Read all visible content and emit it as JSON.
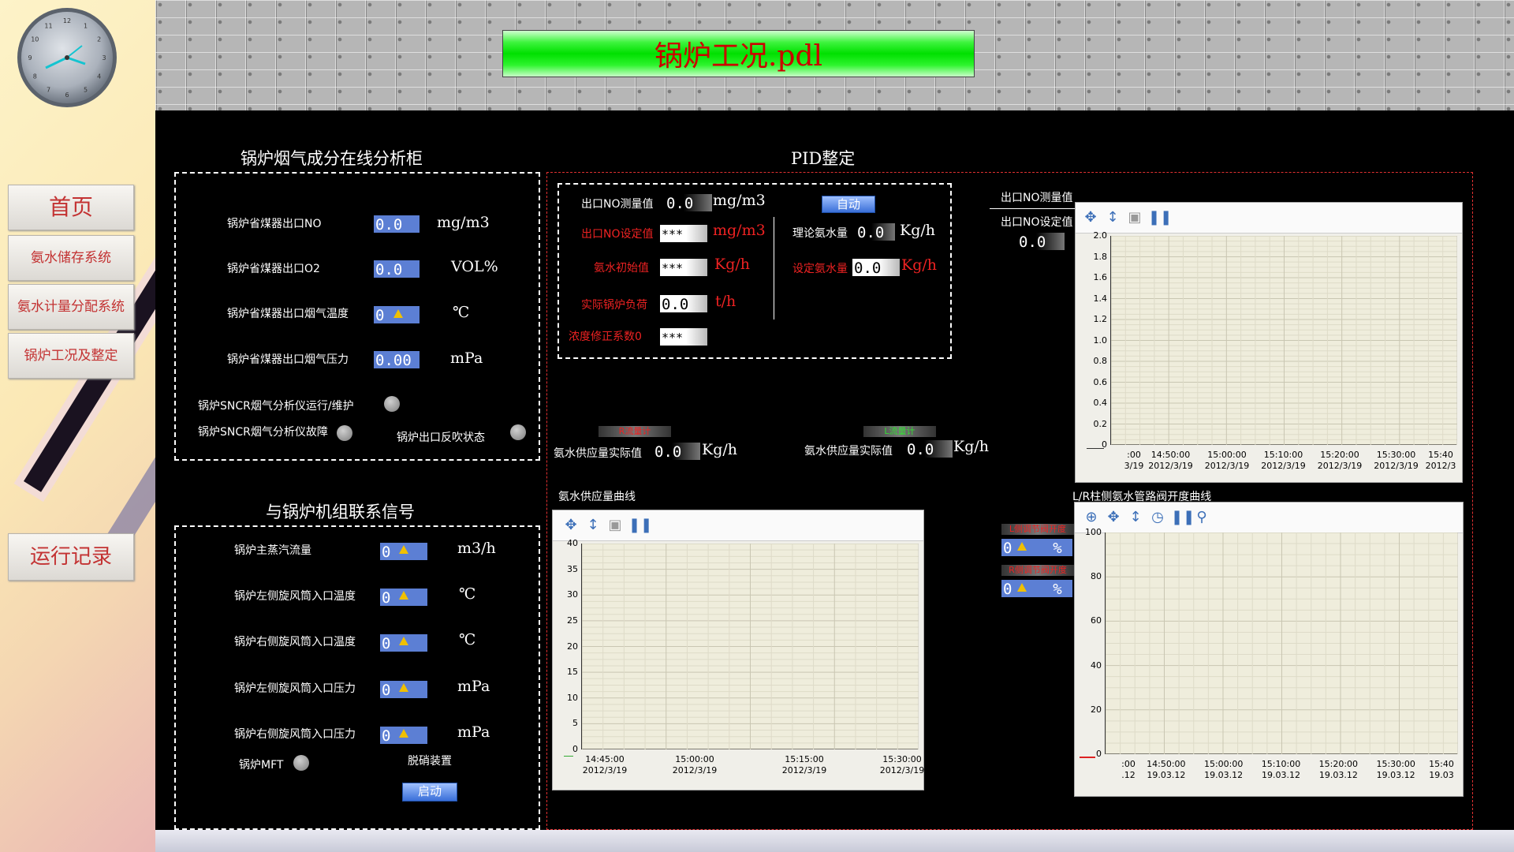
{
  "app_title": "锅炉工况.pdl",
  "sidebar": {
    "home": "首页",
    "items": [
      "氨水储存系统",
      "氨水计量分配系统",
      "锅炉工况及整定"
    ],
    "run_log": "运行记录",
    "clock_numbers": [
      "12",
      "1",
      "2",
      "3",
      "4",
      "5",
      "6",
      "7",
      "8",
      "9",
      "10",
      "11"
    ]
  },
  "analyzer": {
    "title": "锅炉烟气成分在线分析柜",
    "rows": [
      {
        "label": "锅炉省煤器出口NO",
        "value": "0.0",
        "unit": "mg/m3"
      },
      {
        "label": "锅炉省煤器出口O2",
        "value": "0.0",
        "unit": "VOL%"
      },
      {
        "label": "锅炉省煤器出口烟气温度",
        "value": "0",
        "unit": "℃"
      },
      {
        "label": "锅炉省煤器出口烟气压力",
        "value": "0.00",
        "unit": "mPa"
      }
    ],
    "status1": "锅炉SNCR烟气分析仪运行/维护",
    "status2": "锅炉SNCR烟气分析仪故障",
    "status3": "锅炉出口反吹状态"
  },
  "boiler_link": {
    "title": "与锅炉机组联系信号",
    "rows": [
      {
        "label": "锅炉主蒸汽流量",
        "value": "0",
        "unit": "m3/h"
      },
      {
        "label": "锅炉左侧旋风筒入口温度",
        "value": "0",
        "unit": "℃"
      },
      {
        "label": "锅炉右侧旋风筒入口温度",
        "value": "0",
        "unit": "℃"
      },
      {
        "label": "锅炉左侧旋风筒入口压力",
        "value": "0",
        "unit": "mPa"
      },
      {
        "label": "锅炉右侧旋风筒入口压力",
        "value": "0",
        "unit": "mPa"
      }
    ],
    "mft": "锅炉MFT",
    "denox": "脱硝装置",
    "start": "启动"
  },
  "pid": {
    "title": "PID整定",
    "out_no_meas_label": "出口NO测量值",
    "out_no_meas_value": "0.0",
    "out_no_meas_unit": "mg/m3",
    "out_no_set_label": "出口NO设定值",
    "out_no_set_value": "***",
    "out_no_set_unit": "mg/m3",
    "nh3_init_label": "氨水初始值",
    "nh3_init_value": "***",
    "nh3_init_unit": "Kg/h",
    "load_label": "实际锅炉负荷",
    "load_value": "0.0",
    "load_unit": "t/h",
    "conc_label": "浓度修正系数0",
    "conc_value": "***",
    "auto_btn": "自动",
    "theory_label": "理论氨水量",
    "theory_value": "0.0",
    "theory_unit": "Kg/h",
    "set_nh3_label": "设定氨水量",
    "set_nh3_value": "0.0",
    "set_nh3_unit": "Kg/h",
    "right_meas_label": "出口NO测量值",
    "right_set_label": "出口NO设定值",
    "right_set_value": "0.0",
    "supply1_label": "氨水供应量实际值",
    "supply1_value": "0.0",
    "supply1_unit": "Kg/h",
    "supply2_label": "氨水供应量实际值",
    "supply2_value": "0.0",
    "supply2_unit": "Kg/h",
    "tag1": "R流量计",
    "tag2": "L流量计",
    "valve1_value": "0",
    "valve1_unit": "%",
    "valve2_value": "0",
    "valve2_unit": "%",
    "valve_tag1": "L侧调节阀开度",
    "valve_tag2": "R侧调节阀开度"
  },
  "chart_data": [
    {
      "type": "line",
      "title": "",
      "ylim": [
        0,
        2.0
      ],
      "yticks": [
        "0",
        "0.2",
        "0.4",
        "0.6",
        "0.8",
        "1.0",
        "1.2",
        "1.4",
        "1.6",
        "1.8",
        "2.0"
      ],
      "xticks": [
        ":00\n3/19",
        "14:50:00\n2012/3/19",
        "15:00:00\n2012/3/19",
        "15:10:00\n2012/3/19",
        "15:20:00\n2012/3/19",
        "15:30:00\n2012/3/19",
        "15:40\n2012/3"
      ],
      "series": []
    },
    {
      "type": "line",
      "title": "氨水供应量曲线",
      "ylim": [
        0,
        40
      ],
      "yticks": [
        "0",
        "5",
        "10",
        "15",
        "20",
        "25",
        "30",
        "35",
        "40"
      ],
      "xticks": [
        "14:45:00\n2012/3/19",
        "15:00:00\n2012/3/19",
        "15:15:00\n2012/3/19",
        "15:30:00\n2012/3/19"
      ],
      "series": []
    },
    {
      "type": "line",
      "title": "L/R柱侧氨水管路阀开度曲线",
      "ylim": [
        0,
        100
      ],
      "yticks": [
        "0",
        "20",
        "40",
        "60",
        "80",
        "100"
      ],
      "xticks": [
        ":00\n.12",
        "14:50:00\n19.03.12",
        "15:00:00\n19.03.12",
        "15:10:00\n19.03.12",
        "15:20:00\n19.03.12",
        "15:30:00\n19.03.12",
        "15:40\n19.03"
      ],
      "series": []
    }
  ]
}
